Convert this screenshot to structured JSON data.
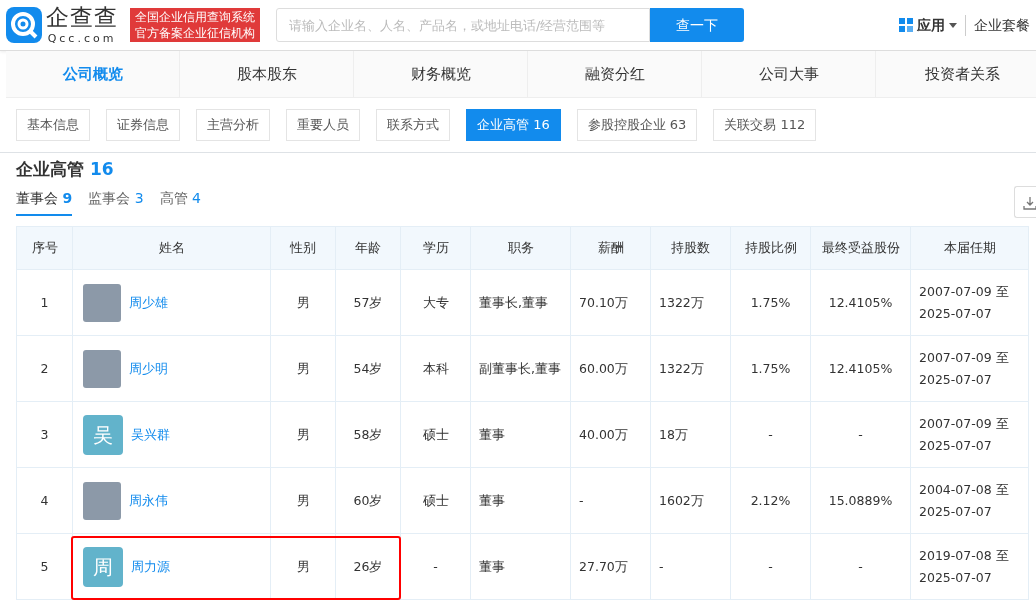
{
  "header": {
    "logo_name": "企查查",
    "logo_domain": "Qcc.com",
    "badge_lines": [
      "全国企业信用查询系统",
      "官方备案企业征信机构"
    ],
    "search": {
      "placeholder": "请输入企业名、人名、产品名，或地址电话/经营范围等"
    },
    "search_button": "查一下",
    "apps": "应用",
    "plans": "企业套餐"
  },
  "main_tabs": [
    {
      "label": "公司概览",
      "selected": true
    },
    {
      "label": "股本股东",
      "selected": false
    },
    {
      "label": "财务概览",
      "selected": false
    },
    {
      "label": "融资分红",
      "selected": false
    },
    {
      "label": "公司大事",
      "selected": false
    },
    {
      "label": "投资者关系",
      "selected": false
    }
  ],
  "sub_tabs": [
    {
      "label": "基本信息",
      "selected": false
    },
    {
      "label": "证券信息",
      "selected": false
    },
    {
      "label": "主营分析",
      "selected": false
    },
    {
      "label": "重要人员",
      "selected": false
    },
    {
      "label": "联系方式",
      "selected": false
    },
    {
      "label": "企业高管",
      "count": "16",
      "selected": true
    },
    {
      "label": "参股控股企业",
      "count": "63",
      "selected": false
    },
    {
      "label": "关联交易",
      "count": "112",
      "selected": false
    }
  ],
  "section": {
    "title": "企业高管",
    "count": "16"
  },
  "filter_tabs": [
    {
      "label": "董事会",
      "count": "9",
      "selected": true
    },
    {
      "label": "监事会",
      "count": "3",
      "selected": false
    },
    {
      "label": "高管",
      "count": "4",
      "selected": false
    }
  ],
  "table": {
    "columns": [
      "序号",
      "姓名",
      "性别",
      "年龄",
      "学历",
      "职务",
      "薪酬",
      "持股数",
      "持股比例",
      "最终受益股份",
      "本届任期"
    ],
    "rows": [
      {
        "index": "1",
        "avatar": {
          "kind": "photo"
        },
        "name": "周少雄",
        "gender": "男",
        "age": "57岁",
        "education": "大专",
        "position": "董事长,董事",
        "salary": "70.10万",
        "shares": "1322万",
        "ratio": "1.75%",
        "beneficial": "12.4105%",
        "term": "2007-07-09 至 2025-07-07",
        "highlighted": false
      },
      {
        "index": "2",
        "avatar": {
          "kind": "photo"
        },
        "name": "周少明",
        "gender": "男",
        "age": "54岁",
        "education": "本科",
        "position": "副董事长,董事",
        "salary": "60.00万",
        "shares": "1322万",
        "ratio": "1.75%",
        "beneficial": "12.4105%",
        "term": "2007-07-09 至 2025-07-07",
        "highlighted": false
      },
      {
        "index": "3",
        "avatar": {
          "kind": "letter",
          "text": "吴"
        },
        "name": "吴兴群",
        "gender": "男",
        "age": "58岁",
        "education": "硕士",
        "position": "董事",
        "salary": "40.00万",
        "shares": "18万",
        "ratio": "-",
        "beneficial": "-",
        "term": "2007-07-09 至 2025-07-07",
        "highlighted": false
      },
      {
        "index": "4",
        "avatar": {
          "kind": "photo"
        },
        "name": "周永伟",
        "gender": "男",
        "age": "60岁",
        "education": "硕士",
        "position": "董事",
        "salary": "-",
        "shares": "1602万",
        "ratio": "2.12%",
        "beneficial": "15.0889%",
        "term": "2004-07-08 至 2025-07-07",
        "highlighted": false
      },
      {
        "index": "5",
        "avatar": {
          "kind": "letter",
          "text": "周"
        },
        "name": "周力源",
        "gender": "男",
        "age": "26岁",
        "education": "-",
        "position": "董事",
        "salary": "27.70万",
        "shares": "-",
        "ratio": "-",
        "beneficial": "-",
        "term": "2019-07-08 至 2025-07-07",
        "highlighted": true
      }
    ]
  }
}
